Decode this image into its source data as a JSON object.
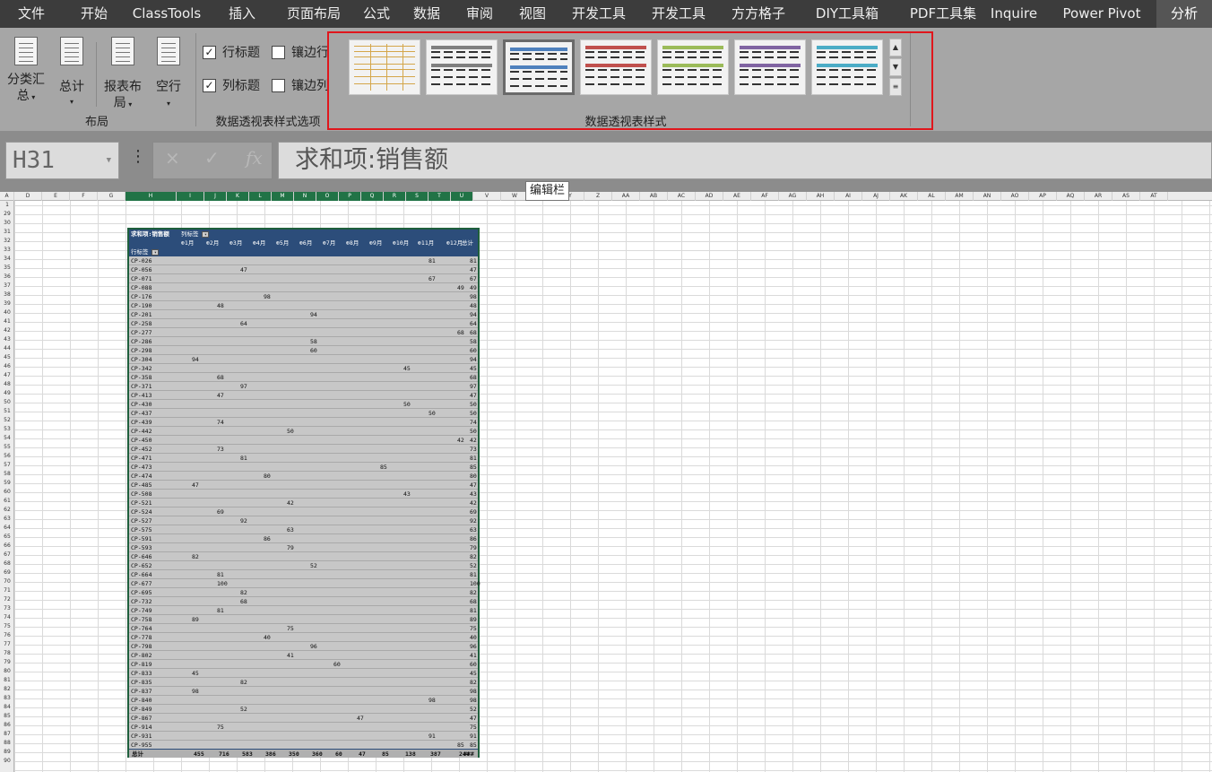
{
  "tabs": [
    {
      "label": "文件"
    },
    {
      "label": "开始"
    },
    {
      "label": "ClassTools"
    },
    {
      "label": "插入"
    },
    {
      "label": "页面布局"
    },
    {
      "label": "公式"
    },
    {
      "label": "数据"
    },
    {
      "label": "审阅"
    },
    {
      "label": "视图"
    },
    {
      "label": "开发工具"
    },
    {
      "label": "开发工具"
    },
    {
      "label": "方方格子"
    },
    {
      "label": "DIY工具箱"
    },
    {
      "label": "PDF工具集"
    },
    {
      "label": "Inquire"
    },
    {
      "label": "Power Pivot"
    },
    {
      "label": "分析"
    }
  ],
  "ribbon": {
    "layout_group": {
      "subtotal_1": "分类汇",
      "subtotal_2": "总",
      "grand_total": "总计",
      "report_layout_1": "报表布",
      "report_layout_2": "局",
      "blank_rows": "空行",
      "label": "布局"
    },
    "options_group": {
      "row_headers": "行标题",
      "banded_rows": "镶边行",
      "col_headers": "列标题",
      "banded_cols": "镶边列",
      "label": "数据透视表样式选项"
    },
    "styles_group": {
      "label": "数据透视表样式"
    },
    "style_swatches": [
      {
        "name": "Light 1",
        "accent": "#d4a64a"
      },
      {
        "name": "Light 2",
        "accent": "#7f7f7f"
      },
      {
        "name": "Light 3",
        "accent": "#4f81bd"
      },
      {
        "name": "Light 4",
        "accent": "#c0504d"
      },
      {
        "name": "Light 5",
        "accent": "#9bbb59"
      },
      {
        "name": "Light 6",
        "accent": "#8064a2"
      },
      {
        "name": "Light 7",
        "accent": "#4bacc6"
      }
    ]
  },
  "formula_bar": {
    "name_box": "H31",
    "cancel_icon": "×",
    "enter_icon": "✓",
    "fx_label": "fx",
    "formula": "求和项:销售额",
    "tooltip": "编辑栏"
  },
  "column_headers": [
    "A",
    "D",
    "E",
    "F",
    "G",
    "H",
    "I",
    "J",
    "K",
    "L",
    "M",
    "N",
    "O",
    "P",
    "Q",
    "R",
    "S",
    "T",
    "U",
    "V",
    "W",
    "X",
    "Y",
    "Z",
    "AA",
    "AB",
    "AC",
    "AD",
    "AE",
    "AF",
    "AG",
    "AH",
    "AI",
    "AJ",
    "AK",
    "AL",
    "AM",
    "AN",
    "AO",
    "AP",
    "AQ",
    "AR",
    "AS",
    "AT"
  ],
  "row_headers": [
    "1",
    "29",
    "30",
    "31",
    "32",
    "33",
    "34",
    "35",
    "36",
    "37",
    "38",
    "39",
    "40",
    "41",
    "42",
    "43",
    "44",
    "45",
    "46",
    "47",
    "48",
    "49",
    "50",
    "51",
    "52",
    "53",
    "54",
    "55",
    "56",
    "57",
    "58",
    "59",
    "60",
    "61",
    "62",
    "63",
    "64",
    "65",
    "66",
    "67",
    "68",
    "69",
    "70",
    "71",
    "72",
    "73",
    "74",
    "75",
    "76",
    "77",
    "78",
    "79",
    "80",
    "81",
    "82",
    "83",
    "84",
    "85",
    "86",
    "87",
    "88",
    "89",
    "90"
  ],
  "pivot": {
    "value_label": "求和项:销售额",
    "col_label": "列标签",
    "row_label": "行标签",
    "months": [
      "1月",
      "2月",
      "3月",
      "4月",
      "5月",
      "6月",
      "7月",
      "8月",
      "9月",
      "10月",
      "11月",
      "12月"
    ],
    "total_header": "总计",
    "rows": [
      {
        "id": "CP-026",
        "m": 11,
        "v": "81",
        "t": "81"
      },
      {
        "id": "CP-056",
        "m": 3,
        "v": "47",
        "t": "47"
      },
      {
        "id": "CP-071",
        "m": 11,
        "v": "67",
        "t": "67"
      },
      {
        "id": "CP-088",
        "m": 12,
        "v": "49",
        "t": "49"
      },
      {
        "id": "CP-176",
        "m": 4,
        "v": "98",
        "t": "98"
      },
      {
        "id": "CP-190",
        "m": 2,
        "v": "48",
        "t": "48"
      },
      {
        "id": "CP-201",
        "m": 6,
        "v": "94",
        "t": "94"
      },
      {
        "id": "CP-258",
        "m": 3,
        "v": "64",
        "t": "64"
      },
      {
        "id": "CP-277",
        "m": 12,
        "v": "68",
        "t": "68"
      },
      {
        "id": "CP-286",
        "m": 6,
        "v": "58",
        "t": "58"
      },
      {
        "id": "CP-298",
        "m": 6,
        "v": "60",
        "t": "60"
      },
      {
        "id": "CP-304",
        "m": 1,
        "v": "94",
        "t": "94"
      },
      {
        "id": "CP-342",
        "m": 10,
        "v": "45",
        "t": "45"
      },
      {
        "id": "CP-358",
        "m": 2,
        "v": "68",
        "t": "68"
      },
      {
        "id": "CP-371",
        "m": 3,
        "v": "97",
        "t": "97"
      },
      {
        "id": "CP-413",
        "m": 2,
        "v": "47",
        "t": "47"
      },
      {
        "id": "CP-430",
        "m": 10,
        "v": "50",
        "t": "50"
      },
      {
        "id": "CP-437",
        "m": 11,
        "v": "50",
        "t": "50"
      },
      {
        "id": "CP-439",
        "m": 2,
        "v": "74",
        "t": "74"
      },
      {
        "id": "CP-442",
        "m": 5,
        "v": "50",
        "t": "50"
      },
      {
        "id": "CP-450",
        "m": 12,
        "v": "42",
        "t": "42"
      },
      {
        "id": "CP-452",
        "m": 2,
        "v": "73",
        "t": "73"
      },
      {
        "id": "CP-471",
        "m": 3,
        "v": "81",
        "t": "81"
      },
      {
        "id": "CP-473",
        "m": 9,
        "v": "85",
        "t": "85"
      },
      {
        "id": "CP-474",
        "m": 4,
        "v": "80",
        "t": "80"
      },
      {
        "id": "CP-485",
        "m": 1,
        "v": "47",
        "t": "47"
      },
      {
        "id": "CP-508",
        "m": 10,
        "v": "43",
        "t": "43"
      },
      {
        "id": "CP-521",
        "m": 5,
        "v": "42",
        "t": "42"
      },
      {
        "id": "CP-524",
        "m": 2,
        "v": "69",
        "t": "69"
      },
      {
        "id": "CP-527",
        "m": 3,
        "v": "92",
        "t": "92"
      },
      {
        "id": "CP-575",
        "m": 5,
        "v": "63",
        "t": "63"
      },
      {
        "id": "CP-591",
        "m": 4,
        "v": "86",
        "t": "86"
      },
      {
        "id": "CP-593",
        "m": 5,
        "v": "79",
        "t": "79"
      },
      {
        "id": "CP-646",
        "m": 1,
        "v": "82",
        "t": "82"
      },
      {
        "id": "CP-652",
        "m": 6,
        "v": "52",
        "t": "52"
      },
      {
        "id": "CP-664",
        "m": 2,
        "v": "81",
        "t": "81"
      },
      {
        "id": "CP-677",
        "m": 2,
        "v": "100",
        "t": "100"
      },
      {
        "id": "CP-695",
        "m": 3,
        "v": "82",
        "t": "82"
      },
      {
        "id": "CP-732",
        "m": 3,
        "v": "68",
        "t": "68"
      },
      {
        "id": "CP-749",
        "m": 2,
        "v": "81",
        "t": "81"
      },
      {
        "id": "CP-758",
        "m": 1,
        "v": "89",
        "t": "89"
      },
      {
        "id": "CP-764",
        "m": 5,
        "v": "75",
        "t": "75"
      },
      {
        "id": "CP-778",
        "m": 4,
        "v": "40",
        "t": "40"
      },
      {
        "id": "CP-798",
        "m": 6,
        "v": "96",
        "t": "96"
      },
      {
        "id": "CP-802",
        "m": 5,
        "v": "41",
        "t": "41"
      },
      {
        "id": "CP-819",
        "m": 7,
        "v": "60",
        "t": "60"
      },
      {
        "id": "CP-833",
        "m": 1,
        "v": "45",
        "t": "45"
      },
      {
        "id": "CP-835",
        "m": 3,
        "v": "82",
        "t": "82"
      },
      {
        "id": "CP-837",
        "m": 1,
        "v": "98",
        "t": "98"
      },
      {
        "id": "CP-840",
        "m": 11,
        "v": "98",
        "t": "98"
      },
      {
        "id": "CP-849",
        "m": 3,
        "v": "52",
        "t": "52"
      },
      {
        "id": "CP-867",
        "m": 8,
        "v": "47",
        "t": "47"
      },
      {
        "id": "CP-914",
        "m": 2,
        "v": "75",
        "t": "75"
      },
      {
        "id": "CP-931",
        "m": 11,
        "v": "91",
        "t": "91"
      },
      {
        "id": "CP-955",
        "m": 12,
        "v": "85",
        "t": "85"
      }
    ],
    "total_label": "总计",
    "totals": [
      "455",
      "716",
      "583",
      "386",
      "350",
      "360",
      "60",
      "47",
      "85",
      "138",
      "387",
      "244",
      "###"
    ]
  }
}
